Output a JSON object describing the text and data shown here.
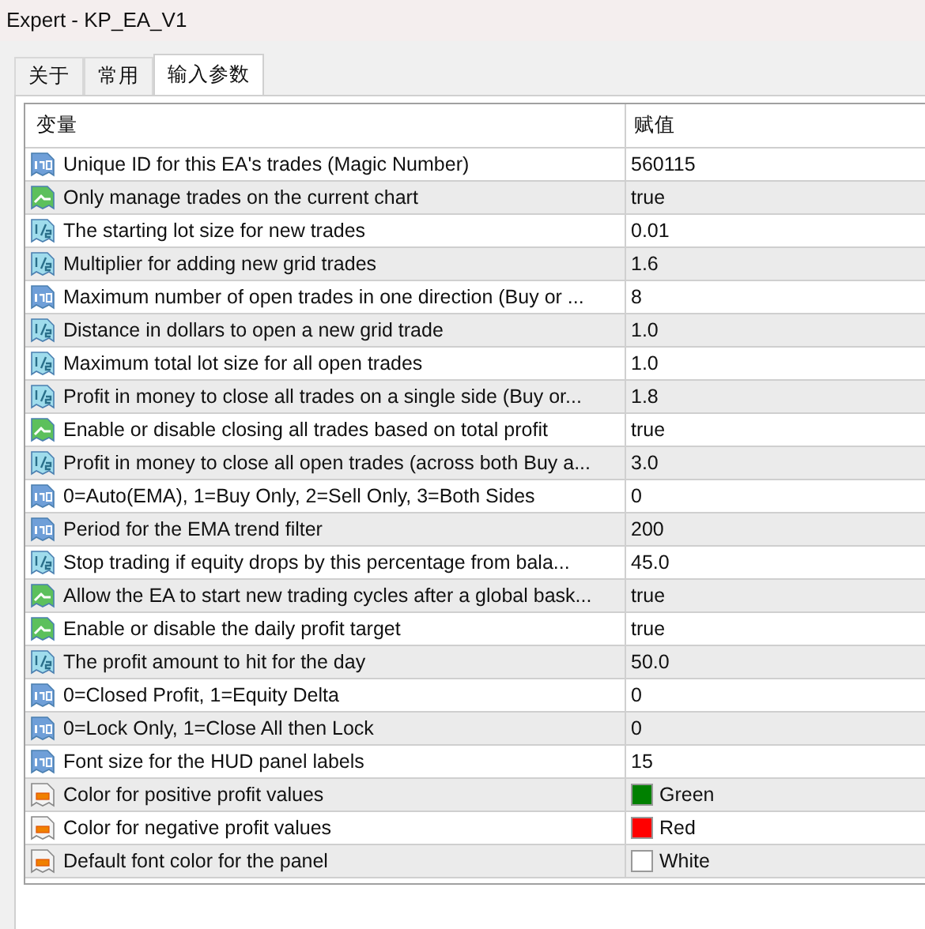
{
  "window": {
    "title": "Expert - KP_EA_V1"
  },
  "tabs": [
    {
      "label": "关于",
      "selected": false
    },
    {
      "label": "常用",
      "selected": false
    },
    {
      "label": "输入参数",
      "selected": true
    }
  ],
  "table": {
    "columns": [
      "变量",
      "赋值"
    ],
    "rows": [
      {
        "kind": "int",
        "name": "Unique ID for this EA's trades (Magic Number)",
        "value": "560115"
      },
      {
        "kind": "bool",
        "name": "Only manage trades on the current chart",
        "value": "true"
      },
      {
        "kind": "double",
        "name": "The starting lot size for new trades",
        "value": "0.01"
      },
      {
        "kind": "double",
        "name": "Multiplier for adding new grid trades",
        "value": "1.6"
      },
      {
        "kind": "int",
        "name": "Maximum number of open trades in one direction (Buy or ...",
        "value": "8"
      },
      {
        "kind": "double",
        "name": "Distance in dollars to open a new grid trade",
        "value": "1.0"
      },
      {
        "kind": "double",
        "name": "Maximum total lot size for all open trades",
        "value": "1.0"
      },
      {
        "kind": "double",
        "name": "Profit in money to close all trades on a single side (Buy or...",
        "value": "1.8"
      },
      {
        "kind": "bool",
        "name": "Enable or disable closing all trades based on total profit",
        "value": "true"
      },
      {
        "kind": "double",
        "name": "Profit in money to close all open trades (across both Buy a...",
        "value": "3.0"
      },
      {
        "kind": "int",
        "name": "0=Auto(EMA), 1=Buy Only, 2=Sell Only, 3=Both Sides",
        "value": "0"
      },
      {
        "kind": "int",
        "name": "Period for the EMA trend filter",
        "value": "200"
      },
      {
        "kind": "double",
        "name": "Stop trading if equity drops by this percentage from bala...",
        "value": "45.0"
      },
      {
        "kind": "bool",
        "name": "Allow the EA to start new trading cycles after a global bask...",
        "value": "true"
      },
      {
        "kind": "bool",
        "name": "Enable or disable the daily profit target",
        "value": "true"
      },
      {
        "kind": "double",
        "name": "The profit amount to hit for the day",
        "value": "50.0"
      },
      {
        "kind": "int",
        "name": "0=Closed Profit, 1=Equity Delta",
        "value": "0"
      },
      {
        "kind": "int",
        "name": "0=Lock Only, 1=Close All then Lock",
        "value": "0"
      },
      {
        "kind": "int",
        "name": "Font size for the HUD panel labels",
        "value": "15"
      },
      {
        "kind": "color",
        "name": "Color for positive profit values",
        "value": "Green",
        "color": "#008000"
      },
      {
        "kind": "color",
        "name": "Color for negative profit values",
        "value": "Red",
        "color": "#ff0000"
      },
      {
        "kind": "color",
        "name": "Default font color for the panel",
        "value": "White",
        "color": "#ffffff"
      }
    ]
  }
}
